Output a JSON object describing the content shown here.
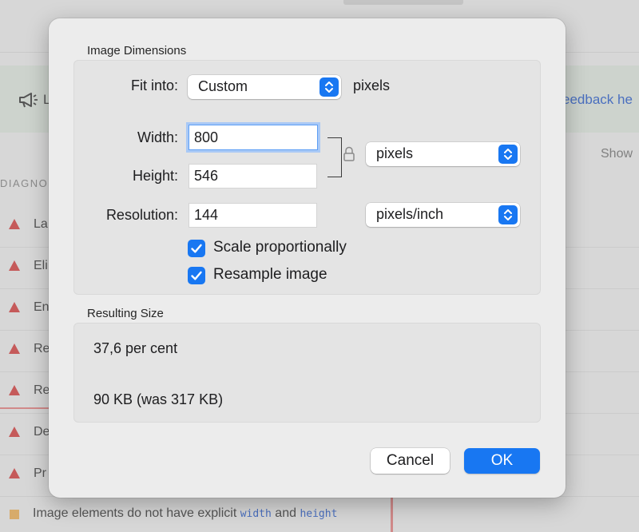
{
  "background": {
    "banner_text": "L",
    "banner_link": "eedback he",
    "show_label": "Show",
    "diagnostics_heading": "DIAGNOS",
    "rows": [
      "La",
      "Eli",
      "En",
      "Re",
      "Re",
      "De",
      "Pr"
    ],
    "bottom_row": {
      "prefix": "Image elements do not have explicit ",
      "code1": "width",
      "middle": " and ",
      "code2": "height"
    }
  },
  "dialog": {
    "image_dimensions": {
      "section_title": "Image Dimensions",
      "fit_into_label": "Fit into:",
      "fit_into_value": "Custom",
      "fit_into_unit": "pixels",
      "width_label": "Width:",
      "width_value": "800",
      "height_label": "Height:",
      "height_value": "546",
      "size_unit_value": "pixels",
      "resolution_label": "Resolution:",
      "resolution_value": "144",
      "resolution_unit_value": "pixels/inch",
      "scale_proportionally_label": "Scale proportionally",
      "scale_proportionally_checked": true,
      "resample_image_label": "Resample image",
      "resample_image_checked": true
    },
    "resulting_size": {
      "section_title": "Resulting Size",
      "percent": "37,6 per cent",
      "file_size": "90 KB (was 317 KB)"
    },
    "buttons": {
      "cancel": "Cancel",
      "ok": "OK"
    }
  },
  "colors": {
    "accent": "#1877f2",
    "dialog_bg": "#ececec",
    "focus_ring": "#a9c9f6"
  }
}
